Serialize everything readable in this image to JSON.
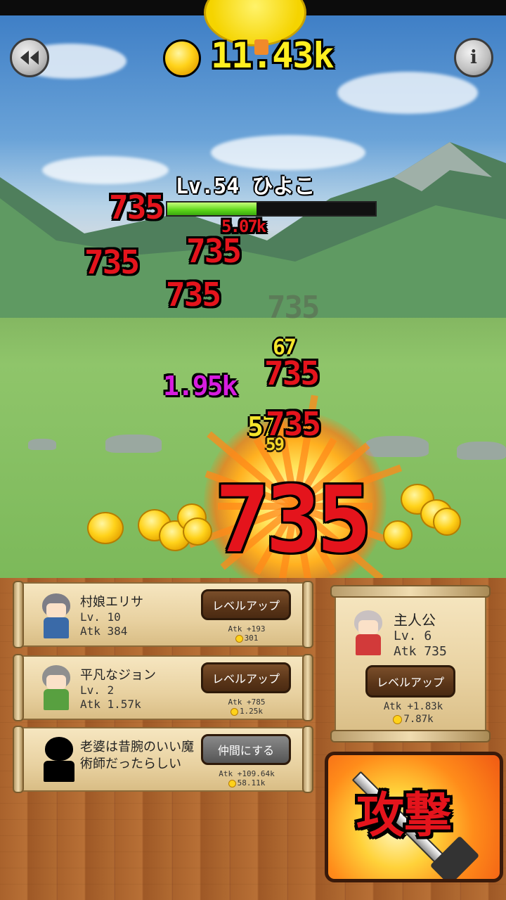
{
  "hud": {
    "gold": "11.43k",
    "back_icon": "rewind-icon",
    "info_icon": "info-icon",
    "info_label": "i"
  },
  "enemy": {
    "label": "Lv.54 ひよこ",
    "hp_fraction": 0.43
  },
  "damage_popups": [
    {
      "text": "735",
      "style": "red"
    },
    {
      "text": "5.07k",
      "style": "red"
    },
    {
      "text": "735",
      "style": "red"
    },
    {
      "text": "735",
      "style": "red"
    },
    {
      "text": "735",
      "style": "red"
    },
    {
      "text": "735",
      "style": "ghost"
    },
    {
      "text": "67",
      "style": "yellow"
    },
    {
      "text": "735",
      "style": "red"
    },
    {
      "text": "1.95k",
      "style": "purple"
    },
    {
      "text": "57",
      "style": "yellow"
    },
    {
      "text": "735",
      "style": "red"
    },
    {
      "text": "59",
      "style": "yellow"
    },
    {
      "text": "735",
      "style": "red-big"
    }
  ],
  "allies": [
    {
      "name": "村娘エリサ",
      "level": "Lv. 10",
      "attack": "Atk 384",
      "button": "レベルアップ",
      "gain": "Atk +193",
      "cost": "301"
    },
    {
      "name": "平凡なジョン",
      "level": "Lv. 2",
      "attack": "Atk 1.57k",
      "button": "レベルアップ",
      "gain": "Atk +785",
      "cost": "1.25k"
    },
    {
      "name": "老婆は昔腕のいい魔術師だったらしい",
      "name_line1": "老婆は昔腕のいい魔",
      "name_line2": "術師だったらしい",
      "button": "仲間にする",
      "gain": "Atk +109.64k",
      "cost": "58.11k"
    }
  ],
  "hero": {
    "name": "主人公",
    "level": "Lv. 6",
    "attack": "Atk 735",
    "button": "レベルアップ",
    "gain": "Atk +1.83k",
    "cost": "7.87k"
  },
  "attack_button": {
    "label": "攻撃"
  },
  "colors": {
    "damage_red": "#e4141c",
    "gold_text": "#ffef20",
    "hp_green": "#5cd51a",
    "wood": "#b06a31",
    "attack_orange": "#ff8c1a"
  }
}
